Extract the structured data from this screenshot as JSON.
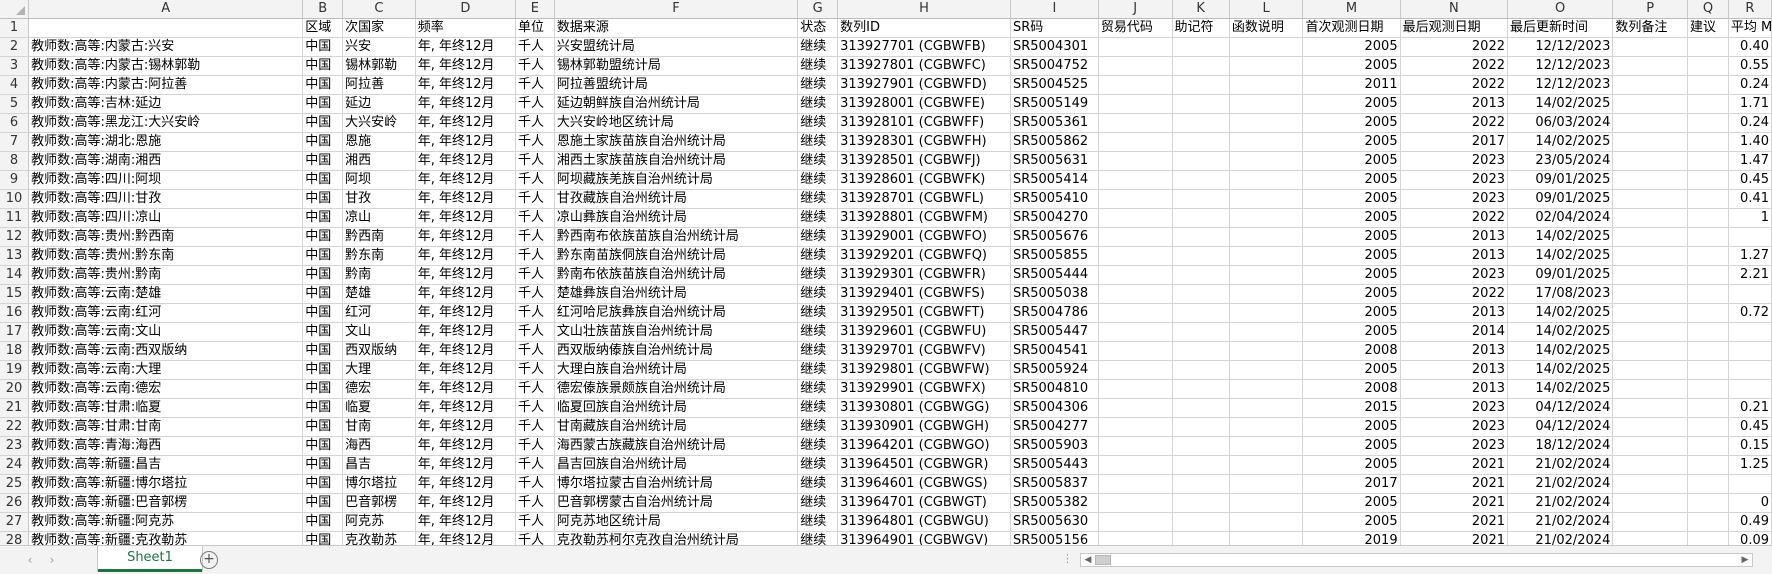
{
  "columns": [
    "",
    "A",
    "B",
    "C",
    "D",
    "E",
    "F",
    "G",
    "H",
    "I",
    "J",
    "K",
    "L",
    "M",
    "N",
    "O",
    "P",
    "Q",
    "R"
  ],
  "header_row": {
    "row_num": "1",
    "A": "",
    "B": "区域",
    "C": "次国家",
    "D": "频率",
    "E": "单位",
    "F": "数据来源",
    "G": "状态",
    "H": "数列ID",
    "I": "SR码",
    "J": "贸易代码",
    "K": "助记符",
    "L": "函数说明",
    "M": "首次观测日期",
    "N": "最后观测日期",
    "O": "最后更新时间",
    "P": "数列备注",
    "Q": "建议",
    "R": "平均 M"
  },
  "rows": [
    {
      "row_num": "2",
      "A": "教师数:高等:内蒙古:兴安",
      "B": "中国",
      "C": "兴安",
      "D": "年, 年终12月",
      "E": "千人",
      "F": "兴安盟统计局",
      "G": "继续",
      "H": "313927701 (CGBWFB)",
      "I": "SR5004301",
      "M": "2005",
      "N": "2022",
      "O": "12/12/2023",
      "R": "0.40"
    },
    {
      "row_num": "3",
      "A": "教师数:高等:内蒙古:锡林郭勒",
      "B": "中国",
      "C": "锡林郭勒",
      "D": "年, 年终12月",
      "E": "千人",
      "F": "锡林郭勒盟统计局",
      "G": "继续",
      "H": "313927801 (CGBWFC)",
      "I": "SR5004752",
      "M": "2005",
      "N": "2022",
      "O": "12/12/2023",
      "R": "0.55"
    },
    {
      "row_num": "4",
      "A": "教师数:高等:内蒙古:阿拉善",
      "B": "中国",
      "C": "阿拉善",
      "D": "年, 年终12月",
      "E": "千人",
      "F": "阿拉善盟统计局",
      "G": "继续",
      "H": "313927901 (CGBWFD)",
      "I": "SR5004525",
      "M": "2011",
      "N": "2022",
      "O": "12/12/2023",
      "R": "0.24"
    },
    {
      "row_num": "5",
      "A": "教师数:高等:吉林:延边",
      "B": "中国",
      "C": "延边",
      "D": "年, 年终12月",
      "E": "千人",
      "F": "延边朝鲜族自治州统计局",
      "G": "继续",
      "H": "313928001 (CGBWFE)",
      "I": "SR5005149",
      "M": "2005",
      "N": "2013",
      "O": "14/02/2025",
      "R": "1.71"
    },
    {
      "row_num": "6",
      "A": "教师数:高等:黑龙江:大兴安岭",
      "B": "中国",
      "C": "大兴安岭",
      "D": "年, 年终12月",
      "E": "千人",
      "F": "大兴安岭地区统计局",
      "G": "继续",
      "H": "313928101 (CGBWFF)",
      "I": "SR5005361",
      "M": "2005",
      "N": "2022",
      "O": "06/03/2024",
      "R": "0.24"
    },
    {
      "row_num": "7",
      "A": "教师数:高等:湖北:恩施",
      "B": "中国",
      "C": "恩施",
      "D": "年, 年终12月",
      "E": "千人",
      "F": "恩施土家族苗族自治州统计局",
      "G": "继续",
      "H": "313928301 (CGBWFH)",
      "I": "SR5005862",
      "M": "2005",
      "N": "2017",
      "O": "14/02/2025",
      "R": "1.40"
    },
    {
      "row_num": "8",
      "A": "教师数:高等:湖南:湘西",
      "B": "中国",
      "C": "湘西",
      "D": "年, 年终12月",
      "E": "千人",
      "F": "湘西土家族苗族自治州统计局",
      "G": "继续",
      "H": "313928501 (CGBWFJ)",
      "I": "SR5005631",
      "M": "2005",
      "N": "2023",
      "O": "23/05/2024",
      "R": "1.47"
    },
    {
      "row_num": "9",
      "A": "教师数:高等:四川:阿坝",
      "B": "中国",
      "C": "阿坝",
      "D": "年, 年终12月",
      "E": "千人",
      "F": "阿坝藏族羌族自治州统计局",
      "G": "继续",
      "H": "313928601 (CGBWFK)",
      "I": "SR5005414",
      "M": "2005",
      "N": "2023",
      "O": "09/01/2025",
      "R": "0.45"
    },
    {
      "row_num": "10",
      "A": "教师数:高等:四川:甘孜",
      "B": "中国",
      "C": "甘孜",
      "D": "年, 年终12月",
      "E": "千人",
      "F": "甘孜藏族自治州统计局",
      "G": "继续",
      "H": "313928701 (CGBWFL)",
      "I": "SR5005410",
      "M": "2005",
      "N": "2023",
      "O": "09/01/2025",
      "R": "0.41"
    },
    {
      "row_num": "11",
      "A": "教师数:高等:四川:凉山",
      "B": "中国",
      "C": "凉山",
      "D": "年, 年终12月",
      "E": "千人",
      "F": "凉山彝族自治州统计局",
      "G": "继续",
      "H": "313928801 (CGBWFM)",
      "I": "SR5004270",
      "M": "2005",
      "N": "2022",
      "O": "02/04/2024",
      "R": "1"
    },
    {
      "row_num": "12",
      "A": "教师数:高等:贵州:黔西南",
      "B": "中国",
      "C": "黔西南",
      "D": "年, 年终12月",
      "E": "千人",
      "F": "黔西南布依族苗族自治州统计局",
      "G": "继续",
      "H": "313929001 (CGBWFO)",
      "I": "SR5005676",
      "M": "2005",
      "N": "2013",
      "O": "14/02/2025",
      "R": ""
    },
    {
      "row_num": "13",
      "A": "教师数:高等:贵州:黔东南",
      "B": "中国",
      "C": "黔东南",
      "D": "年, 年终12月",
      "E": "千人",
      "F": "黔东南苗族侗族自治州统计局",
      "G": "继续",
      "H": "313929201 (CGBWFQ)",
      "I": "SR5005855",
      "M": "2005",
      "N": "2013",
      "O": "14/02/2025",
      "R": "1.27"
    },
    {
      "row_num": "14",
      "A": "教师数:高等:贵州:黔南",
      "B": "中国",
      "C": "黔南",
      "D": "年, 年终12月",
      "E": "千人",
      "F": "黔南布依族苗族自治州统计局",
      "G": "继续",
      "H": "313929301 (CGBWFR)",
      "I": "SR5005444",
      "M": "2005",
      "N": "2023",
      "O": "09/01/2025",
      "R": "2.21"
    },
    {
      "row_num": "15",
      "A": "教师数:高等:云南:楚雄",
      "B": "中国",
      "C": "楚雄",
      "D": "年, 年终12月",
      "E": "千人",
      "F": "楚雄彝族自治州统计局",
      "G": "继续",
      "H": "313929401 (CGBWFS)",
      "I": "SR5005038",
      "M": "2005",
      "N": "2022",
      "O": "17/08/2023",
      "R": ""
    },
    {
      "row_num": "16",
      "A": "教师数:高等:云南:红河",
      "B": "中国",
      "C": "红河",
      "D": "年, 年终12月",
      "E": "千人",
      "F": "红河哈尼族彝族自治州统计局",
      "G": "继续",
      "H": "313929501 (CGBWFT)",
      "I": "SR5004786",
      "M": "2005",
      "N": "2013",
      "O": "14/02/2025",
      "R": "0.72"
    },
    {
      "row_num": "17",
      "A": "教师数:高等:云南:文山",
      "B": "中国",
      "C": "文山",
      "D": "年, 年终12月",
      "E": "千人",
      "F": "文山壮族苗族自治州统计局",
      "G": "继续",
      "H": "313929601 (CGBWFU)",
      "I": "SR5005447",
      "M": "2005",
      "N": "2014",
      "O": "14/02/2025",
      "R": ""
    },
    {
      "row_num": "18",
      "A": "教师数:高等:云南:西双版纳",
      "B": "中国",
      "C": "西双版纳",
      "D": "年, 年终12月",
      "E": "千人",
      "F": "西双版纳傣族自治州统计局",
      "G": "继续",
      "H": "313929701 (CGBWFV)",
      "I": "SR5004541",
      "M": "2008",
      "N": "2013",
      "O": "14/02/2025",
      "R": ""
    },
    {
      "row_num": "19",
      "A": "教师数:高等:云南:大理",
      "B": "中国",
      "C": "大理",
      "D": "年, 年终12月",
      "E": "千人",
      "F": "大理白族自治州统计局",
      "G": "继续",
      "H": "313929801 (CGBWFW)",
      "I": "SR5005924",
      "M": "2005",
      "N": "2013",
      "O": "14/02/2025",
      "R": ""
    },
    {
      "row_num": "20",
      "A": "教师数:高等:云南:德宏",
      "B": "中国",
      "C": "德宏",
      "D": "年, 年终12月",
      "E": "千人",
      "F": "德宏傣族景颇族自治州统计局",
      "G": "继续",
      "H": "313929901 (CGBWFX)",
      "I": "SR5004810",
      "M": "2008",
      "N": "2013",
      "O": "14/02/2025",
      "R": ""
    },
    {
      "row_num": "21",
      "A": "教师数:高等:甘肃:临夏",
      "B": "中国",
      "C": "临夏",
      "D": "年, 年终12月",
      "E": "千人",
      "F": "临夏回族自治州统计局",
      "G": "继续",
      "H": "313930801 (CGBWGG)",
      "I": "SR5004306",
      "M": "2015",
      "N": "2023",
      "O": "04/12/2024",
      "R": "0.21"
    },
    {
      "row_num": "22",
      "A": "教师数:高等:甘肃:甘南",
      "B": "中国",
      "C": "甘南",
      "D": "年, 年终12月",
      "E": "千人",
      "F": "甘南藏族自治州统计局",
      "G": "继续",
      "H": "313930901 (CGBWGH)",
      "I": "SR5004277",
      "M": "2005",
      "N": "2023",
      "O": "04/12/2024",
      "R": "0.45"
    },
    {
      "row_num": "23",
      "A": "教师数:高等:青海:海西",
      "B": "中国",
      "C": "海西",
      "D": "年, 年终12月",
      "E": "千人",
      "F": "海西蒙古族藏族自治州统计局",
      "G": "继续",
      "H": "313964201 (CGBWGO)",
      "I": "SR5005903",
      "M": "2005",
      "N": "2023",
      "O": "18/12/2024",
      "R": "0.15"
    },
    {
      "row_num": "24",
      "A": "教师数:高等:新疆:昌吉",
      "B": "中国",
      "C": "昌吉",
      "D": "年, 年终12月",
      "E": "千人",
      "F": "昌吉回族自治州统计局",
      "G": "继续",
      "H": "313964501 (CGBWGR)",
      "I": "SR5005443",
      "M": "2005",
      "N": "2021",
      "O": "21/02/2024",
      "R": "1.25"
    },
    {
      "row_num": "25",
      "A": "教师数:高等:新疆:博尔塔拉",
      "B": "中国",
      "C": "博尔塔拉",
      "D": "年, 年终12月",
      "E": "千人",
      "F": "博尔塔拉蒙古自治州统计局",
      "G": "继续",
      "H": "313964601 (CGBWGS)",
      "I": "SR5005837",
      "M": "2017",
      "N": "2021",
      "O": "21/02/2024",
      "R": ""
    },
    {
      "row_num": "26",
      "A": "教师数:高等:新疆:巴音郭楞",
      "B": "中国",
      "C": "巴音郭楞",
      "D": "年, 年终12月",
      "E": "千人",
      "F": "巴音郭楞蒙古自治州统计局",
      "G": "继续",
      "H": "313964701 (CGBWGT)",
      "I": "SR5005382",
      "M": "2005",
      "N": "2021",
      "O": "21/02/2024",
      "R": "0"
    },
    {
      "row_num": "27",
      "A": "教师数:高等:新疆:阿克苏",
      "B": "中国",
      "C": "阿克苏",
      "D": "年, 年终12月",
      "E": "千人",
      "F": "阿克苏地区统计局",
      "G": "继续",
      "H": "313964801 (CGBWGU)",
      "I": "SR5005630",
      "M": "2005",
      "N": "2021",
      "O": "21/02/2024",
      "R": "0.49"
    },
    {
      "row_num": "28",
      "A": "教师数:高等:新疆:克孜勒苏",
      "B": "中国",
      "C": "克孜勒苏",
      "D": "年, 年终12月",
      "E": "千人",
      "F": "克孜勒苏柯尔克孜自治州统计局",
      "G": "继续",
      "H": "313964901 (CGBWGV)",
      "I": "SR5005156",
      "M": "2019",
      "N": "2021",
      "O": "21/02/2024",
      "R": "0.09"
    }
  ],
  "sheet_tabs": [
    {
      "label": "Sheet1",
      "active": true
    }
  ],
  "nav": {
    "prev": "‹",
    "next": "›",
    "add": "+"
  },
  "icons": {
    "add_sheet": "plus-circle-icon",
    "scroll_left": "triangle-left-icon",
    "scroll_right": "triangle-right-icon"
  },
  "colors": {
    "header_bg": "#f3f3f3",
    "grid_line": "#d4d4d4",
    "tab_accent": "#1f7244"
  }
}
